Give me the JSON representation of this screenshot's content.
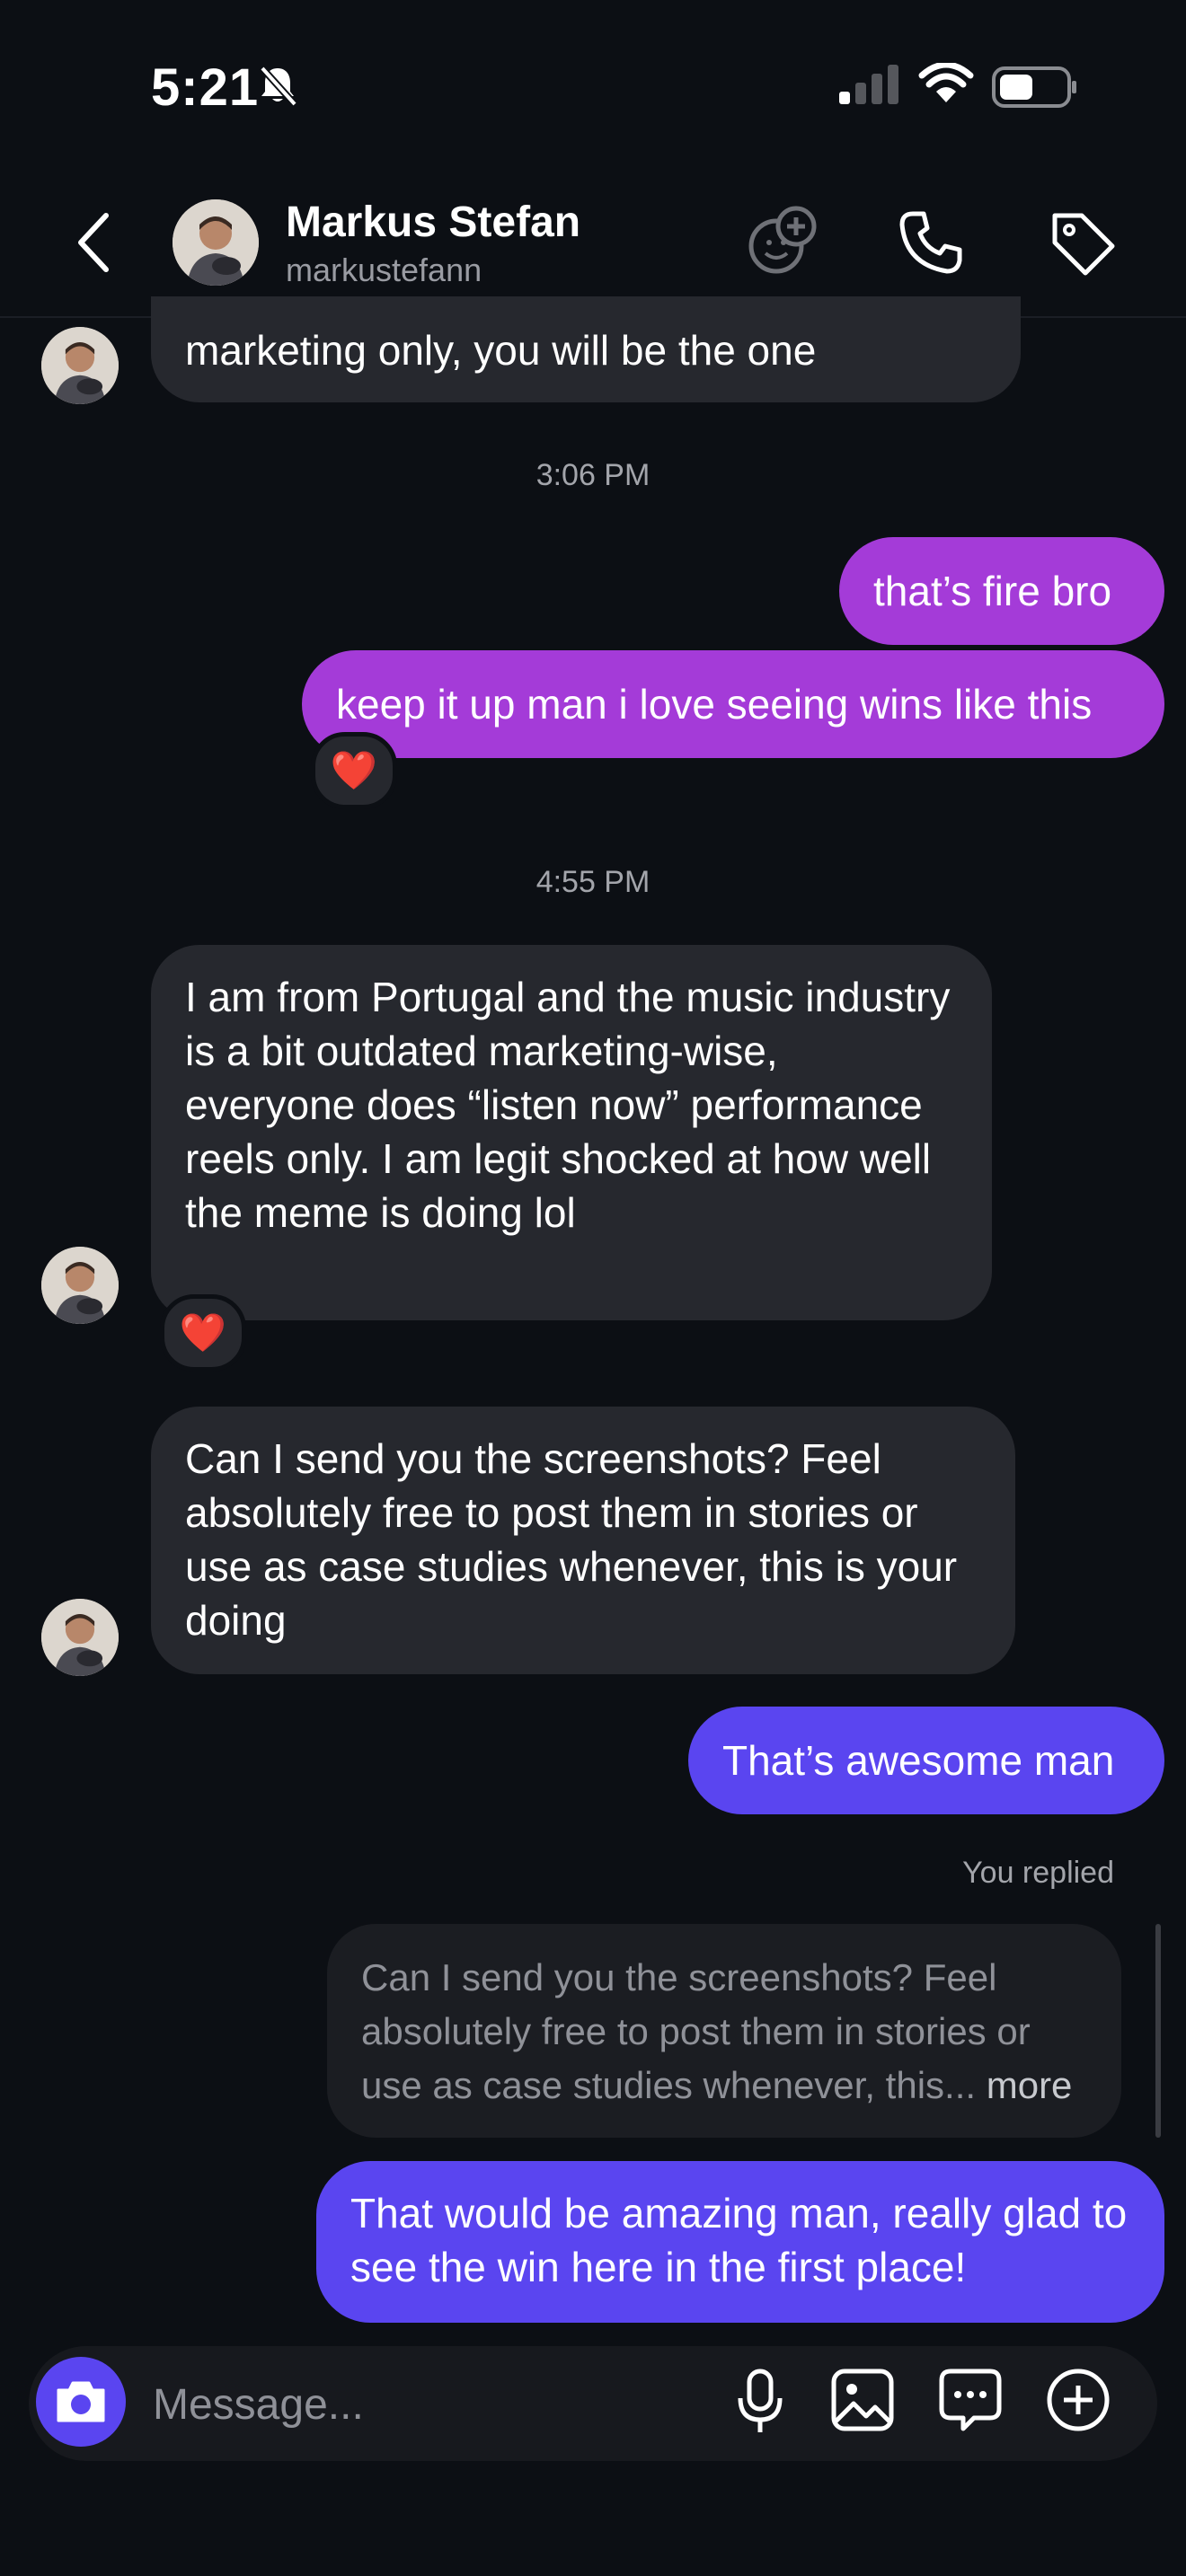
{
  "status_bar": {
    "time": "5:21"
  },
  "header": {
    "name": "Markus Stefan",
    "username": "markustefann"
  },
  "messages": {
    "partial_incoming": "marketing only, you will be the one",
    "timestamp_1": "3:06 PM",
    "out_1": "that’s fire bro",
    "out_2": "keep it up man i love seeing wins like this",
    "reaction_1": "❤️",
    "timestamp_2": "4:55 PM",
    "in_1": "I am from Portugal and the music industry is a bit outdated marketing-wise, everyone does “listen now” performance reels only. I am legit shocked at how well the meme is doing lol",
    "reaction_2": "❤️",
    "in_2": "Can I send you the screenshots? Feel absolutely free to post them in stories or use as case studies whenever, this is your doing",
    "out_3": "That’s awesome man",
    "replied_label": "You replied",
    "quote_text": "Can I send you the screenshots? Feel absolutely free to post them in stories or use as case studies whenever, this...",
    "quote_more": "more",
    "out_4": "That would be amazing man, really glad to see the win here in the first place!"
  },
  "composer": {
    "placeholder": "Message..."
  },
  "colors": {
    "background": "#0c0f14",
    "incoming_bubble": "#26282e",
    "outgoing_purple": "#a43bd8",
    "outgoing_blue": "#5a45f0",
    "camera_button": "#5a45f0"
  },
  "icons": [
    "bell-slash-icon",
    "signal-icon",
    "wifi-icon",
    "battery-icon",
    "back-chevron-icon",
    "sticker-add-icon",
    "phone-icon",
    "tag-icon",
    "camera-icon",
    "microphone-icon",
    "gallery-icon",
    "chat-bubble-icon",
    "plus-circle-icon"
  ]
}
